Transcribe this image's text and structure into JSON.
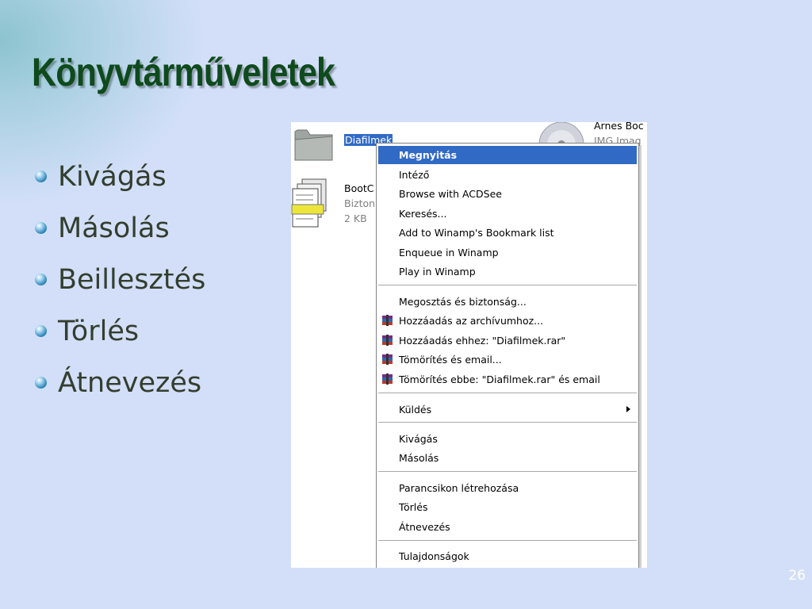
{
  "slide": {
    "title": "Könyvtárműveletek",
    "page_number": "26",
    "bullets": [
      "Kivágás",
      "Másolás",
      "Beillesztés",
      "Törlés",
      "Átnevezés"
    ]
  },
  "explorer": {
    "folder_name": "Diafilmek",
    "file": {
      "name": "BootC",
      "type": "Bizton",
      "size": "2 KB"
    },
    "image_file": {
      "name": "Arnes Boc",
      "type": "IMG Imag"
    }
  },
  "context_menu": {
    "items": [
      {
        "label": "Megnyitás",
        "selected": true
      },
      {
        "label": "Intéző"
      },
      {
        "label": "Browse with ACDSee"
      },
      {
        "label": "Keresés..."
      },
      {
        "label": "Add to Winamp's Bookmark list"
      },
      {
        "label": "Enqueue in Winamp"
      },
      {
        "label": "Play in Winamp"
      },
      {
        "label": "Megosztás és biztonság..."
      },
      {
        "label": "Hozzáadás az archívumhoz...",
        "icon": "winrar-icon"
      },
      {
        "label": "Hozzáadás ehhez: \"Diafilmek.rar\"",
        "icon": "winrar-icon"
      },
      {
        "label": "Tömörítés és email...",
        "icon": "winrar-icon"
      },
      {
        "label": "Tömörítés ebbe: \"Diafilmek.rar\" és email",
        "icon": "winrar-icon"
      },
      {
        "label": "Küldés",
        "submenu": true
      },
      {
        "label": "Kivágás"
      },
      {
        "label": "Másolás"
      },
      {
        "label": "Parancsikon létrehozása"
      },
      {
        "label": "Törlés"
      },
      {
        "label": "Átnevezés"
      },
      {
        "label": "Tulajdonságok"
      }
    ]
  },
  "colors": {
    "title": "#0e4a1c",
    "selection": "#316ac5",
    "background": "#d3dff9"
  }
}
